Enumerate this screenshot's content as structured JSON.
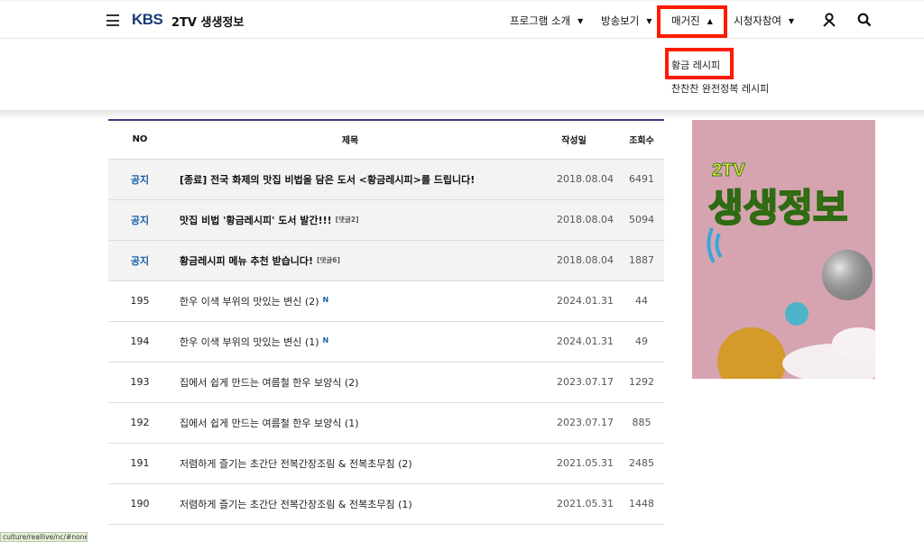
{
  "header": {
    "logo": "KBS",
    "program_title": "2TV 생생정보",
    "nav": [
      {
        "label": "프로그램 소개"
      },
      {
        "label": "방송보기"
      },
      {
        "label": "매거진"
      },
      {
        "label": "시청자참여"
      }
    ],
    "icons": {
      "menu": "hamburger-menu-icon",
      "user": "user-icon",
      "search": "search-icon"
    }
  },
  "dropdown": {
    "items": [
      "황금 레시피",
      "찬찬찬 완전정복 레시피"
    ]
  },
  "board": {
    "columns": {
      "no": "NO",
      "title": "제목",
      "date": "작성일",
      "views": "조회수"
    },
    "rows": [
      {
        "no": "공지",
        "title": "[종료] 전국 화제의 맛집 비법을 담은 도서 <황금레시피>를 드립니다!",
        "comment": "",
        "new": "",
        "date": "2018.08.04",
        "views": "6491",
        "notice": true
      },
      {
        "no": "공지",
        "title": "맛집 비법 '황금레시피' 도서 발간!!!",
        "comment": "[댓글2]",
        "new": "",
        "date": "2018.08.04",
        "views": "5094",
        "notice": true
      },
      {
        "no": "공지",
        "title": "황금레시피 메뉴 추천 받습니다!",
        "comment": "[댓글6]",
        "new": "",
        "date": "2018.08.04",
        "views": "1887",
        "notice": true
      },
      {
        "no": "195",
        "title": "한우 이색 부위의 맛있는 변신 (2)",
        "comment": "",
        "new": "N",
        "date": "2024.01.31",
        "views": "44",
        "notice": false
      },
      {
        "no": "194",
        "title": "한우 이색 부위의 맛있는 변신 (1)",
        "comment": "",
        "new": "N",
        "date": "2024.01.31",
        "views": "49",
        "notice": false
      },
      {
        "no": "193",
        "title": "집에서 쉽게 만드는 여름철 한우 보양식 (2)",
        "comment": "",
        "new": "",
        "date": "2023.07.17",
        "views": "1292",
        "notice": false
      },
      {
        "no": "192",
        "title": "집에서 쉽게 만드는 여름철 한우 보양식 (1)",
        "comment": "",
        "new": "",
        "date": "2023.07.17",
        "views": "885",
        "notice": false
      },
      {
        "no": "191",
        "title": "저렴하게 즐기는 초간단 전복간장조림 & 전복초무침 (2)",
        "comment": "",
        "new": "",
        "date": "2021.05.31",
        "views": "2485",
        "notice": false
      },
      {
        "no": "190",
        "title": "저렴하게 즐기는 초간단 전복간장조림 & 전복초무침 (1)",
        "comment": "",
        "new": "",
        "date": "2021.05.31",
        "views": "1448",
        "notice": false
      }
    ]
  },
  "banner": {
    "text_top": "2TV",
    "text_main": "생생정보"
  },
  "status_url": "culture/reallive/nc/#none",
  "colors": {
    "highlight": "#ff1a00",
    "notice": "#1a5fa8",
    "banner_bg": "#d6a4b1"
  }
}
